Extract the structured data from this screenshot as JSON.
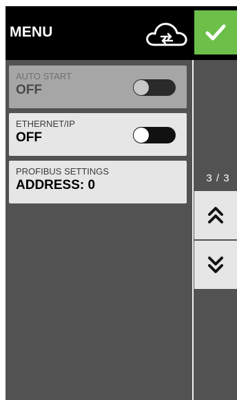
{
  "header": {
    "title": "MENU",
    "cloud_icon": "cloud-sync-icon",
    "confirm_icon": "checkmark-icon",
    "confirm_color": "#6cc04a"
  },
  "settings": [
    {
      "label": "AUTO START",
      "value": "OFF",
      "toggle": "off",
      "enabled": false
    },
    {
      "label": "ETHERNET/IP",
      "value": "OFF",
      "toggle": "off",
      "enabled": true
    },
    {
      "label": "PROFIBUS SETTINGS",
      "value": "ADDRESS: 0"
    }
  ],
  "pager": {
    "indicator": "3 / 3",
    "up_icon": "double-chevron-up-icon",
    "down_icon": "double-chevron-down-icon"
  }
}
